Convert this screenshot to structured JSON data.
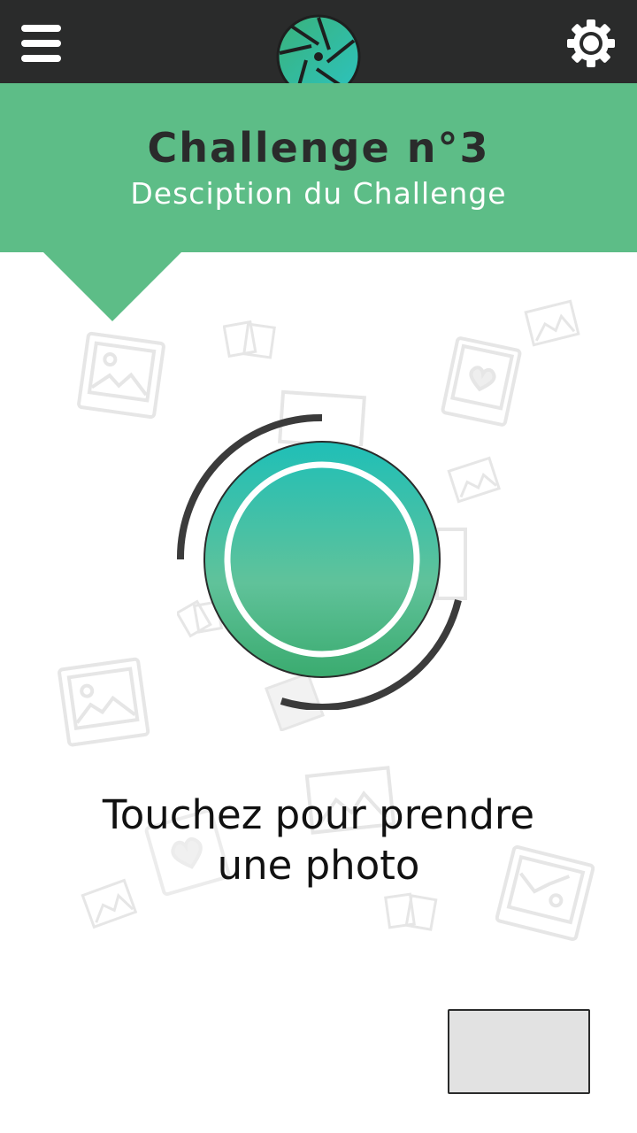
{
  "header": {
    "menu_icon": "hamburger-menu-icon",
    "logo_icon": "camera-aperture-icon",
    "settings_icon": "gear-icon"
  },
  "challenge": {
    "title": "Challenge n°3",
    "description": "Desciption du Challenge"
  },
  "capture": {
    "prompt_line1": "Touchez pour prendre",
    "prompt_line2": "une photo"
  },
  "gallery": {
    "thumbnail_icon": "last-photo-thumbnail"
  },
  "colors": {
    "topbar": "#2a2b2b",
    "accent_green": "#5dbd87",
    "shutter_top": "#1fbfb7",
    "shutter_bottom": "#3aab6f",
    "ring": "#3b3b3b"
  }
}
